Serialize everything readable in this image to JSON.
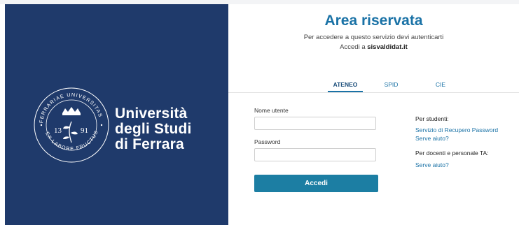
{
  "branding": {
    "university_line1": "Università",
    "university_line2": "degli Studi",
    "university_line3": "di Ferrara",
    "seal_ring_text": "FERRARIAE UNIVERSITAS · EX LABORE FRUCTUS",
    "seal_left_year": "13",
    "seal_right_year": "91",
    "colors": {
      "panel": "#1f3a6b",
      "accent": "#1a72a6"
    }
  },
  "header": {
    "title": "Area riservata",
    "subtitle": "Per accedere a questo servizio devi autenticarti",
    "access_prefix": "Accedi a",
    "access_site": "sisvaldidat.it"
  },
  "tabs": [
    {
      "label": "ATENEO",
      "active": true
    },
    {
      "label": "SPID",
      "active": false
    },
    {
      "label": "CIE",
      "active": false
    }
  ],
  "form": {
    "username_label": "Nome utente",
    "username_value": "",
    "password_label": "Password",
    "password_value": "",
    "submit_label": "Accedi"
  },
  "help": {
    "students_header": "Per studenti:",
    "students_recovery_link": "Servizio di Recupero Password",
    "students_help_link": "Serve aiuto?",
    "staff_header": "Per docenti e personale TA:",
    "staff_help_link": "Serve aiuto?"
  }
}
